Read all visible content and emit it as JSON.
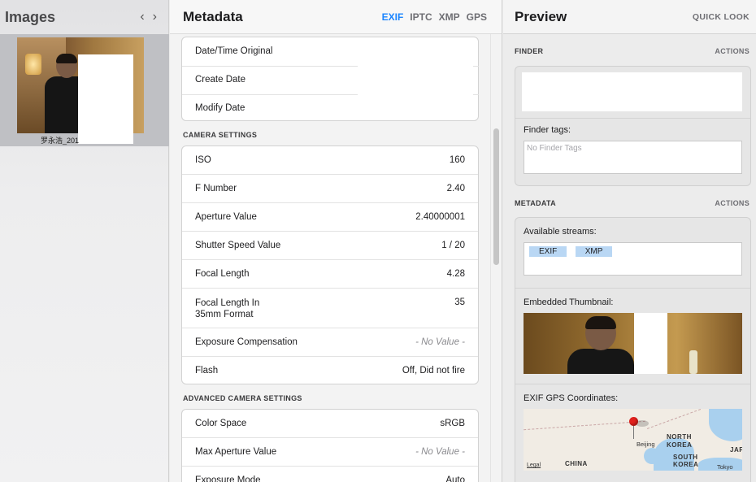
{
  "images_pane": {
    "title": "Images",
    "prev_icon": "‹",
    "next_icon": "›",
    "thumbnail_caption": "罗永浩_201"
  },
  "metadata_pane": {
    "title": "Metadata",
    "tabs": [
      "EXIF",
      "IPTC",
      "XMP",
      "GPS"
    ],
    "active_tab": "EXIF",
    "dates": [
      {
        "label": "Date/Time Original",
        "value": ""
      },
      {
        "label": "Create Date",
        "value": ""
      },
      {
        "label": "Modify Date",
        "value": ""
      }
    ],
    "camera_settings_title": "CAMERA SETTINGS",
    "camera_settings": [
      {
        "label": "ISO",
        "value": "160"
      },
      {
        "label": "F Number",
        "value": "2.40"
      },
      {
        "label": "Aperture Value",
        "value": "2.40000001"
      },
      {
        "label": "Shutter Speed Value",
        "value": "1 / 20"
      },
      {
        "label": "Focal Length",
        "value": "4.28"
      },
      {
        "label": "Focal Length In\n35mm Format",
        "value": "35"
      },
      {
        "label": "Exposure Compensation",
        "value": "- No Value -"
      },
      {
        "label": "Flash",
        "value": "Off, Did not fire"
      }
    ],
    "advanced_title": "ADVANCED CAMERA SETTINGS",
    "advanced_settings": [
      {
        "label": "Color Space",
        "value": "sRGB"
      },
      {
        "label": "Max Aperture Value",
        "value": "- No Value -"
      },
      {
        "label": "Exposure Mode",
        "value": "Auto"
      }
    ]
  },
  "preview_pane": {
    "title": "Preview",
    "quick_look": "QUICK LOOK",
    "finder_section": "FINDER",
    "finder_actions": "ACTIONS",
    "finder_tags_label": "Finder tags:",
    "finder_tags_placeholder": "No Finder Tags",
    "metadata_section": "METADATA",
    "metadata_actions": "ACTIONS",
    "available_streams_label": "Available streams:",
    "streams": [
      "EXIF",
      "XMP"
    ],
    "embedded_thumbnail_label": "Embedded Thumbnail:",
    "gps_label": "EXIF GPS Coordinates:",
    "map": {
      "legal": "Legal",
      "labels": [
        "CHINA",
        "NORTH",
        "KOREA",
        "SOUTH",
        "KOREA",
        "JAP"
      ],
      "cities": [
        "Beijing",
        "Tokyo"
      ]
    }
  },
  "colors": {
    "accent": "#1a84ff",
    "stream_tag": "#b9d7f4",
    "pin": "#e0201c"
  }
}
